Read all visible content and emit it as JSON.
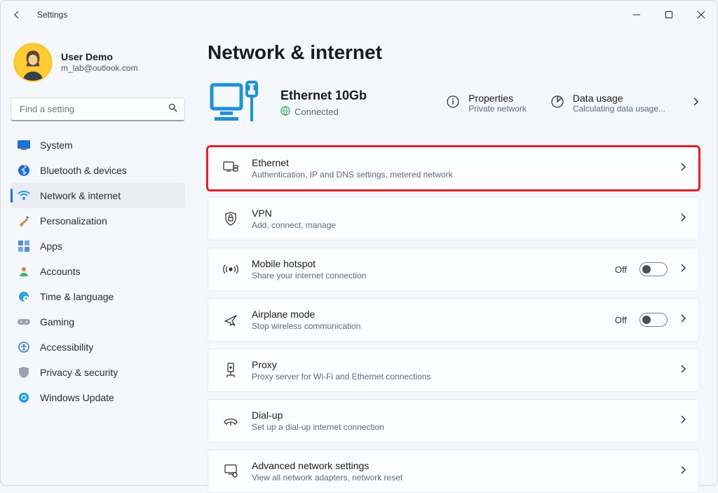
{
  "window": {
    "title": "Settings"
  },
  "user": {
    "name": "User Demo",
    "email": "m_lab@outlook.com"
  },
  "search": {
    "placeholder": "Find a setting"
  },
  "sidebar": {
    "items": [
      {
        "label": "System"
      },
      {
        "label": "Bluetooth & devices"
      },
      {
        "label": "Network & internet"
      },
      {
        "label": "Personalization"
      },
      {
        "label": "Apps"
      },
      {
        "label": "Accounts"
      },
      {
        "label": "Time & language"
      },
      {
        "label": "Gaming"
      },
      {
        "label": "Accessibility"
      },
      {
        "label": "Privacy & security"
      },
      {
        "label": "Windows Update"
      }
    ]
  },
  "page": {
    "title": "Network & internet",
    "connection": {
      "name": "Ethernet 10Gb",
      "status": "Connected",
      "properties": {
        "label": "Properties",
        "sub": "Private network"
      },
      "usage": {
        "label": "Data usage",
        "sub": "Calculating data usage..."
      }
    },
    "rows": [
      {
        "title": "Ethernet",
        "sub": "Authentication, IP and DNS settings, metered network"
      },
      {
        "title": "VPN",
        "sub": "Add, connect, manage"
      },
      {
        "title": "Mobile hotspot",
        "sub": "Share your internet connection",
        "toggle": "Off"
      },
      {
        "title": "Airplane mode",
        "sub": "Stop wireless communication",
        "toggle": "Off"
      },
      {
        "title": "Proxy",
        "sub": "Proxy server for Wi-Fi and Ethernet connections"
      },
      {
        "title": "Dial-up",
        "sub": "Set up a dial-up internet connection"
      },
      {
        "title": "Advanced network settings",
        "sub": "View all network adapters, network reset"
      }
    ]
  }
}
